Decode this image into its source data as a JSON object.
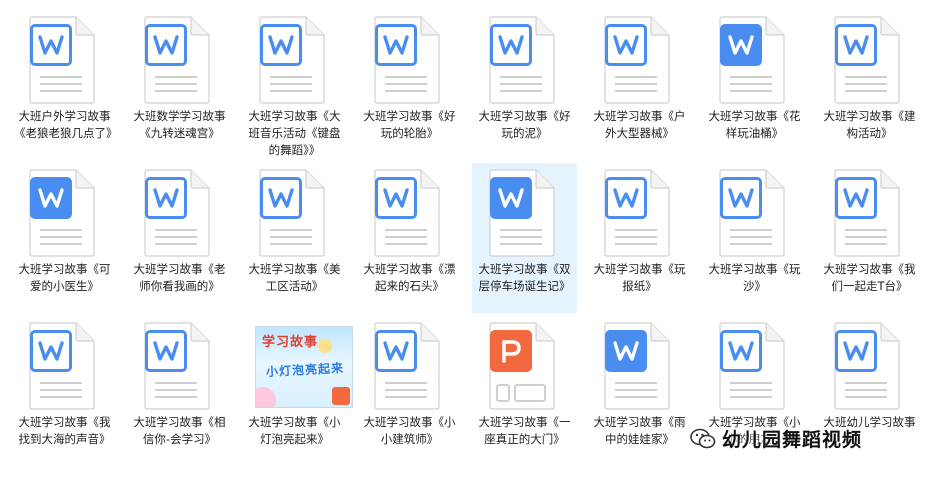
{
  "files": [
    {
      "type": "doc",
      "label": "大班户外学习故事《老狼老狼几点了》"
    },
    {
      "type": "doc",
      "label": "大班数学学习故事《九转迷魂宫》"
    },
    {
      "type": "doc",
      "label": "大班学习故事《大班音乐活动《键盘的舞蹈》》"
    },
    {
      "type": "doc",
      "label": "大班学习故事《好玩的轮胎》"
    },
    {
      "type": "doc",
      "label": "大班学习故事《好玩的泥》"
    },
    {
      "type": "doc",
      "label": "大班学习故事《户外大型器械》"
    },
    {
      "type": "doc-solid",
      "label": "大班学习故事《花样玩油桶》"
    },
    {
      "type": "doc",
      "label": "大班学习故事《建构活动》"
    },
    {
      "type": "doc-solid",
      "label": "大班学习故事《可爱的小医生》"
    },
    {
      "type": "doc",
      "label": "大班学习故事《老师你看我画的》"
    },
    {
      "type": "doc",
      "label": "大班学习故事《美工区活动》"
    },
    {
      "type": "doc",
      "label": "大班学习故事《漂起来的石头》"
    },
    {
      "type": "doc-solid",
      "label": "大班学习故事《双层停车场诞生记》",
      "selected": true
    },
    {
      "type": "doc",
      "label": "大班学习故事《玩报纸》"
    },
    {
      "type": "doc",
      "label": "大班学习故事《玩沙》"
    },
    {
      "type": "doc",
      "label": "大班学习故事《我们一起走T台》"
    },
    {
      "type": "doc",
      "label": "大班学习故事《我找到大海的声音》"
    },
    {
      "type": "doc",
      "label": "大班学习故事《相信你-会学习》"
    },
    {
      "type": "image",
      "label": "大班学习故事《小灯泡亮起来》",
      "image_title": "学习故事",
      "image_subtitle": "小灯泡亮起来"
    },
    {
      "type": "doc",
      "label": "大班学习故事《小小建筑师》"
    },
    {
      "type": "ppt",
      "label": "大班学习故事《一座真正的大门》"
    },
    {
      "type": "doc-solid",
      "label": "大班学习故事《雨中的娃娃家》"
    },
    {
      "type": "doc",
      "label": "大班学习故事《小小的朋友》"
    },
    {
      "type": "doc",
      "label": "大班幼儿学习故事"
    }
  ],
  "watermark": {
    "text": "幼儿园舞蹈视频",
    "icon": "wechat-icon"
  },
  "colors": {
    "word_blue": "#4a8df0",
    "ppt_orange": "#f2693f",
    "selection": "#e5f3ff"
  }
}
